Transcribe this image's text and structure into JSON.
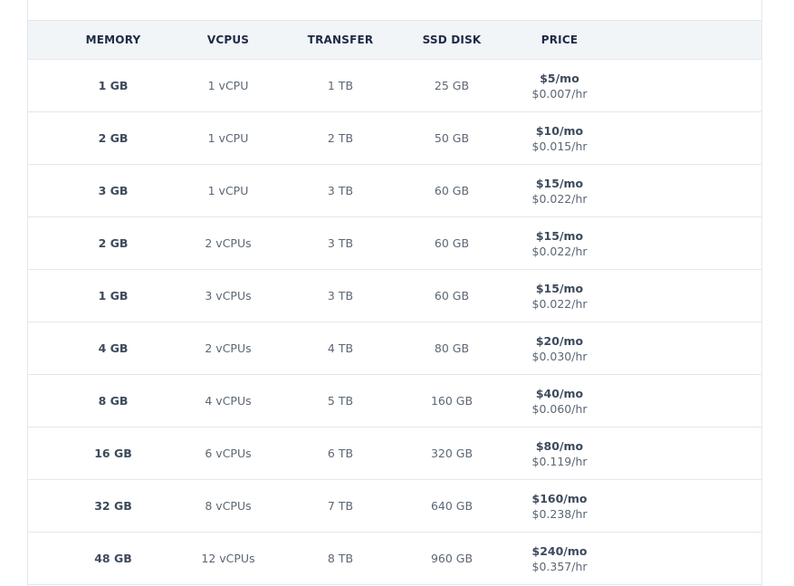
{
  "table": {
    "headers": {
      "memory": "MEMORY",
      "vcpus": "VCPUS",
      "transfer": "TRANSFER",
      "ssd": "SSD DISK",
      "price": "PRICE"
    },
    "rows": [
      {
        "memory": "1 GB",
        "vcpus": "1 vCPU",
        "transfer": "1 TB",
        "ssd": "25 GB",
        "price_mo": "$5/mo",
        "price_hr": "$0.007/hr"
      },
      {
        "memory": "2 GB",
        "vcpus": "1 vCPU",
        "transfer": "2 TB",
        "ssd": "50 GB",
        "price_mo": "$10/mo",
        "price_hr": "$0.015/hr"
      },
      {
        "memory": "3 GB",
        "vcpus": "1 vCPU",
        "transfer": "3 TB",
        "ssd": "60 GB",
        "price_mo": "$15/mo",
        "price_hr": "$0.022/hr"
      },
      {
        "memory": "2 GB",
        "vcpus": "2 vCPUs",
        "transfer": "3 TB",
        "ssd": "60 GB",
        "price_mo": "$15/mo",
        "price_hr": "$0.022/hr"
      },
      {
        "memory": "1 GB",
        "vcpus": "3 vCPUs",
        "transfer": "3 TB",
        "ssd": "60 GB",
        "price_mo": "$15/mo",
        "price_hr": "$0.022/hr"
      },
      {
        "memory": "4 GB",
        "vcpus": "2 vCPUs",
        "transfer": "4 TB",
        "ssd": "80 GB",
        "price_mo": "$20/mo",
        "price_hr": "$0.030/hr"
      },
      {
        "memory": "8 GB",
        "vcpus": "4 vCPUs",
        "transfer": "5 TB",
        "ssd": "160 GB",
        "price_mo": "$40/mo",
        "price_hr": "$0.060/hr"
      },
      {
        "memory": "16 GB",
        "vcpus": "6 vCPUs",
        "transfer": "6 TB",
        "ssd": "320 GB",
        "price_mo": "$80/mo",
        "price_hr": "$0.119/hr"
      },
      {
        "memory": "32 GB",
        "vcpus": "8 vCPUs",
        "transfer": "7 TB",
        "ssd": "640 GB",
        "price_mo": "$160/mo",
        "price_hr": "$0.238/hr"
      },
      {
        "memory": "48 GB",
        "vcpus": "12 vCPUs",
        "transfer": "8 TB",
        "ssd": "960 GB",
        "price_mo": "$240/mo",
        "price_hr": "$0.357/hr"
      }
    ]
  }
}
